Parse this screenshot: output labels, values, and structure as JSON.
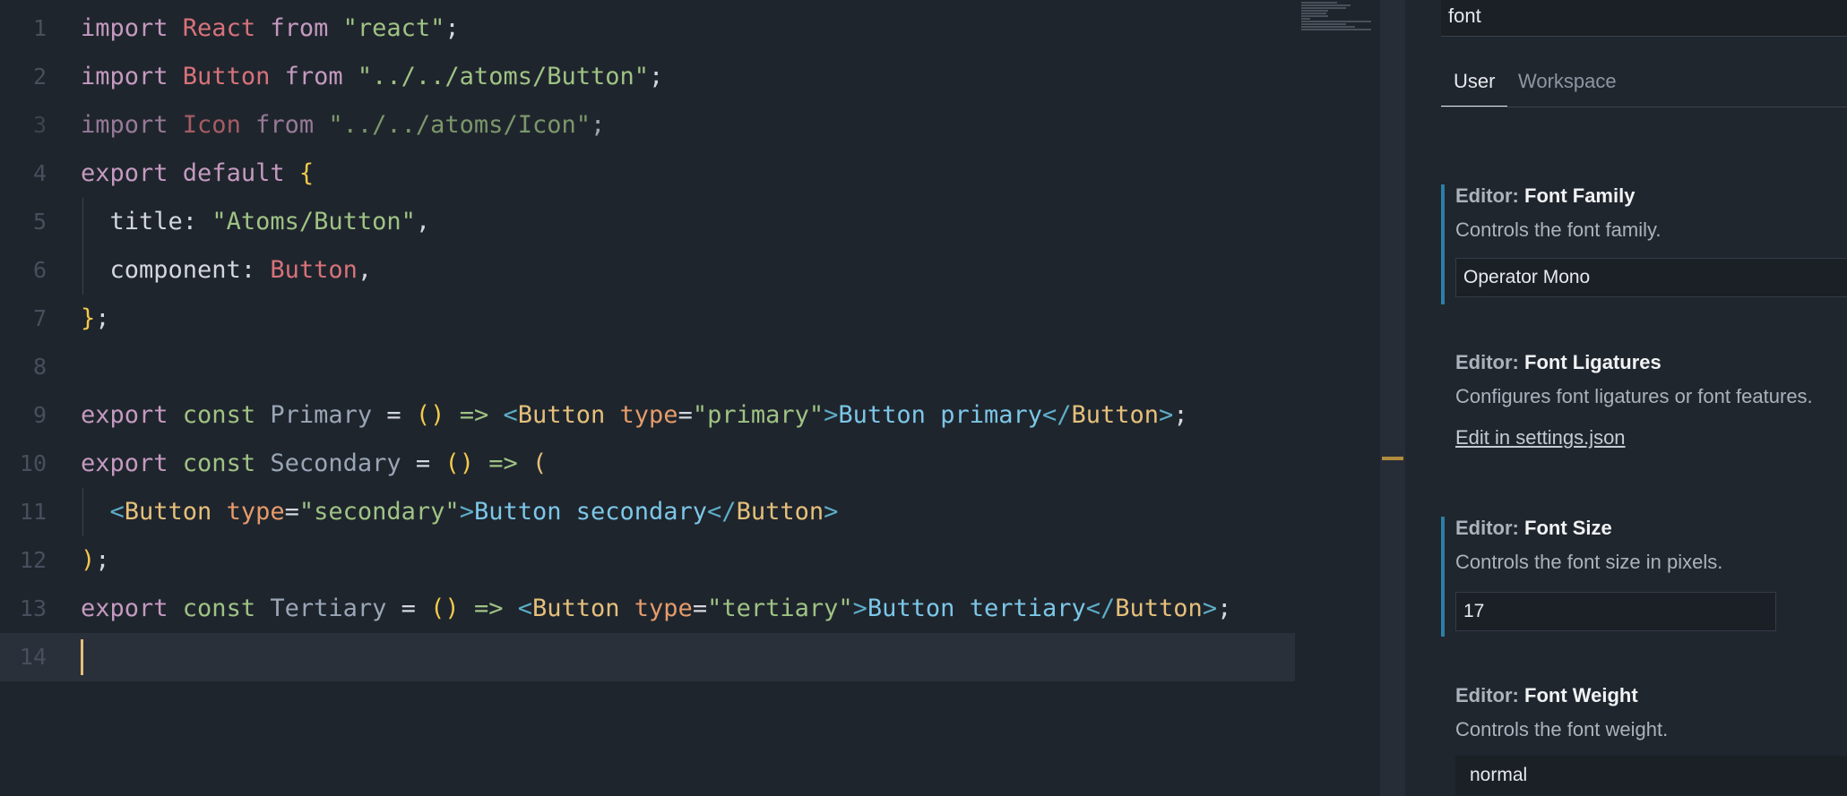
{
  "colors": {
    "background": "#1f252d",
    "keyword": "#c49ac0",
    "identifier": "#d8727a",
    "string": "#9fc384",
    "tag": "#e5c07b",
    "attr": "#e59b6b",
    "jsx_text": "#7cc7e8",
    "punct": "#5dadc8",
    "paren": "#f2c94c",
    "variable": "#9aa6b6",
    "accent": "#2b7fa8"
  },
  "editor": {
    "lines": [
      {
        "num": "1",
        "indent": false,
        "tokens": [
          {
            "t": "import ",
            "c": "keyword"
          },
          {
            "t": "React",
            "c": "identifier"
          },
          {
            "t": " from ",
            "c": "keyword"
          },
          {
            "t": "\"react\"",
            "c": "string"
          },
          {
            "t": ";",
            "c": "plain"
          }
        ]
      },
      {
        "num": "2",
        "indent": false,
        "tokens": [
          {
            "t": "import ",
            "c": "keyword"
          },
          {
            "t": "Button",
            "c": "identifier"
          },
          {
            "t": " from ",
            "c": "keyword"
          },
          {
            "t": "\"../../atoms/Button\"",
            "c": "string"
          },
          {
            "t": ";",
            "c": "plain"
          }
        ]
      },
      {
        "num": "3",
        "indent": false,
        "dim": true,
        "tokens": [
          {
            "t": "import ",
            "c": "keyword"
          },
          {
            "t": "Icon",
            "c": "identifier"
          },
          {
            "t": " from ",
            "c": "keyword"
          },
          {
            "t": "\"../../atoms/Icon\"",
            "c": "string"
          },
          {
            "t": ";",
            "c": "plain"
          }
        ]
      },
      {
        "num": "4",
        "indent": false,
        "tokens": [
          {
            "t": "export ",
            "c": "keyword"
          },
          {
            "t": "default ",
            "c": "keyword"
          },
          {
            "t": "{",
            "c": "paren"
          }
        ]
      },
      {
        "num": "5",
        "indent": true,
        "tokens": [
          {
            "t": "  title",
            "c": "plain"
          },
          {
            "t": ": ",
            "c": "plain"
          },
          {
            "t": "\"Atoms/Button\"",
            "c": "string"
          },
          {
            "t": ",",
            "c": "plain"
          }
        ]
      },
      {
        "num": "6",
        "indent": true,
        "tokens": [
          {
            "t": "  component",
            "c": "plain"
          },
          {
            "t": ": ",
            "c": "plain"
          },
          {
            "t": "Button",
            "c": "identifier"
          },
          {
            "t": ",",
            "c": "plain"
          }
        ]
      },
      {
        "num": "7",
        "indent": false,
        "tokens": [
          {
            "t": "}",
            "c": "paren"
          },
          {
            "t": ";",
            "c": "plain"
          }
        ]
      },
      {
        "num": "8",
        "indent": false,
        "tokens": []
      },
      {
        "num": "9",
        "indent": false,
        "tokens": [
          {
            "t": "export ",
            "c": "keyword"
          },
          {
            "t": "const ",
            "c": "string"
          },
          {
            "t": "Primary",
            "c": "variable"
          },
          {
            "t": " = ",
            "c": "plain"
          },
          {
            "t": "()",
            "c": "paren"
          },
          {
            "t": " => ",
            "c": "string"
          },
          {
            "t": "<",
            "c": "punct"
          },
          {
            "t": "Button",
            "c": "tag"
          },
          {
            "t": " type",
            "c": "attr"
          },
          {
            "t": "=",
            "c": "plain"
          },
          {
            "t": "\"primary\"",
            "c": "string"
          },
          {
            "t": ">",
            "c": "punct"
          },
          {
            "t": "Button primary",
            "c": "jsx_text"
          },
          {
            "t": "</",
            "c": "punct"
          },
          {
            "t": "Button",
            "c": "tag"
          },
          {
            "t": ">",
            "c": "punct"
          },
          {
            "t": ";",
            "c": "plain"
          }
        ]
      },
      {
        "num": "10",
        "indent": false,
        "tokens": [
          {
            "t": "export ",
            "c": "keyword"
          },
          {
            "t": "const ",
            "c": "string"
          },
          {
            "t": "Secondary",
            "c": "variable"
          },
          {
            "t": " = ",
            "c": "plain"
          },
          {
            "t": "()",
            "c": "paren"
          },
          {
            "t": " => ",
            "c": "string"
          },
          {
            "t": "(",
            "c": "tag"
          }
        ]
      },
      {
        "num": "11",
        "indent": true,
        "tokens": [
          {
            "t": "  ",
            "c": "plain"
          },
          {
            "t": "<",
            "c": "punct"
          },
          {
            "t": "Button",
            "c": "tag"
          },
          {
            "t": " type",
            "c": "attr"
          },
          {
            "t": "=",
            "c": "plain"
          },
          {
            "t": "\"secondary\"",
            "c": "string"
          },
          {
            "t": ">",
            "c": "punct"
          },
          {
            "t": "Button secondary",
            "c": "jsx_text"
          },
          {
            "t": "</",
            "c": "punct"
          },
          {
            "t": "Button",
            "c": "tag"
          },
          {
            "t": ">",
            "c": "punct"
          }
        ]
      },
      {
        "num": "12",
        "indent": false,
        "tokens": [
          {
            "t": ")",
            "c": "paren"
          },
          {
            "t": ";",
            "c": "plain"
          }
        ]
      },
      {
        "num": "13",
        "indent": false,
        "tokens": [
          {
            "t": "export ",
            "c": "keyword"
          },
          {
            "t": "const ",
            "c": "string"
          },
          {
            "t": "Tertiary",
            "c": "variable"
          },
          {
            "t": " = ",
            "c": "plain"
          },
          {
            "t": "()",
            "c": "paren"
          },
          {
            "t": " => ",
            "c": "string"
          },
          {
            "t": "<",
            "c": "punct"
          },
          {
            "t": "Button",
            "c": "tag"
          },
          {
            "t": " type",
            "c": "attr"
          },
          {
            "t": "=",
            "c": "plain"
          },
          {
            "t": "\"tertiary\"",
            "c": "string"
          },
          {
            "t": ">",
            "c": "punct"
          },
          {
            "t": "Button tertiary",
            "c": "jsx_text"
          },
          {
            "t": "</",
            "c": "punct"
          },
          {
            "t": "Button",
            "c": "tag"
          },
          {
            "t": ">",
            "c": "punct"
          },
          {
            "t": ";",
            "c": "plain"
          }
        ]
      },
      {
        "num": "14",
        "indent": false,
        "current": true,
        "tokens": []
      }
    ]
  },
  "settings": {
    "search_value": "font",
    "tabs": [
      {
        "label": "User",
        "active": true
      },
      {
        "label": "Workspace",
        "active": false
      }
    ],
    "items": [
      {
        "category": "Editor: ",
        "name": "Font Family",
        "description": "Controls the font family.",
        "value": "Operator Mono",
        "modified": true
      },
      {
        "category": "Editor: ",
        "name": "Font Ligatures",
        "description": "Configures font ligatures or font features.",
        "link": "Edit in settings.json",
        "modified": false
      },
      {
        "category": "Editor: ",
        "name": "Font Size",
        "description": "Controls the font size in pixels.",
        "value": "17",
        "modified": true
      },
      {
        "category": "Editor: ",
        "name": "Font Weight",
        "description": "Controls the font weight.",
        "select_value": "normal",
        "modified": false
      }
    ]
  }
}
